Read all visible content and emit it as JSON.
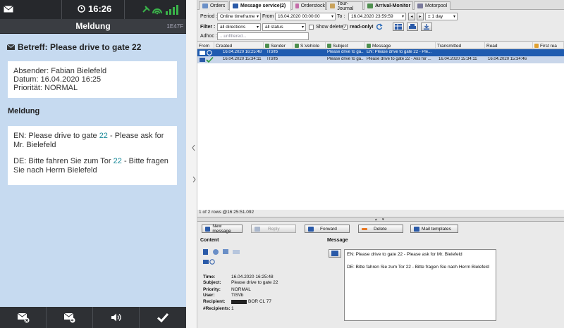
{
  "mobile": {
    "status_bar": {
      "time": "16:26"
    },
    "title": "Meldung",
    "code": "1E47F",
    "subject": "Betreff: Please drive to gate 22",
    "details": {
      "sender": "Absender: Fabian Bielefeld",
      "date": "Datum: 16.04.2020 16:25",
      "priority": "Priorität: NORMAL"
    },
    "message_heading": "Meldung",
    "message_en": {
      "before": "EN: Please drive to gate ",
      "gate": "22",
      "after": " - Please ask for Mr. Bielefeld"
    },
    "message_de": {
      "before": "DE: Bitte fahren Sie zum Tor ",
      "gate": "22",
      "after": " - Bitte fragen Sie nach Herrn Bielefeld"
    },
    "bottom_buttons": [
      "mail-delete-icon",
      "mail-reply-icon",
      "speaker-icon",
      "checkmark-icon"
    ]
  },
  "desktop": {
    "tabs": [
      "Orders",
      "Message service(2)",
      "Orderstock",
      "Tour-Journal",
      "Arrival-Monitor",
      "Motorpool"
    ],
    "period": {
      "label": "Period :",
      "value": "Online timeframe",
      "from_label": "From :",
      "from_value": "16.04.2020 00:00:00",
      "to_label": "To :",
      "to_value": "16.04.2020 23:59:59",
      "step": "± 1 day"
    },
    "filter": {
      "label": "Filter :",
      "directions": "all directions",
      "status": "all status",
      "show_deleted": "Show deleted",
      "read_only": "read-only!"
    },
    "adhoc": {
      "label": "Adhoc :",
      "placeholder": "...unfiltered..."
    },
    "columns": [
      "From",
      "Created",
      "Sender",
      "S.Vehicle",
      "Subject",
      "Message",
      "Transmitted",
      "Read",
      "First rea"
    ],
    "rows": [
      {
        "created": "16.04.2020 16:25:48",
        "sender": "TIS\\fb",
        "vehicle": "",
        "subject": "Please drive to ga...",
        "message": "EN: Please drive to gate 22 - Ple...",
        "transmitted": "",
        "read": "",
        "selected": true
      },
      {
        "created": "16.04.2020 15:34:11",
        "sender": "TIS\\fb",
        "vehicle": "",
        "subject": "Please drive to ga...",
        "message": "Please drive to gate 22 - Aks for ...",
        "transmitted": "16.04.2020 15:34:11",
        "read": "16.04.2020 15:34:46",
        "selected": false
      }
    ],
    "row_count": "1 of 2 rows @16:25:51.092",
    "actions": [
      "New message",
      "Reply",
      "Forward",
      "Delete",
      "Mail templates"
    ],
    "content": {
      "heading": "Content",
      "time_label": "Time:",
      "time": "16.04.2020 16:25:48",
      "subject_label": "Subject:",
      "subject": "Please drive to gate 22",
      "priority_label": "Priority:",
      "priority": "NORMAL",
      "user_label": "User:",
      "user": "TIS\\fb",
      "recipient_label": "Recipient:",
      "recipient": "BOR CL 77",
      "recipients_label": "#Recipients:",
      "recipients": "1"
    },
    "message": {
      "heading": "Message",
      "line_en": "EN: Please drive to gate 22 - Please ask for Mr. Bielefeld",
      "line_de": "DE: Bitte fahren Sie zum Tor 22 - Bitte fragen Sie nach Herrn Bielefeld"
    }
  },
  "colors": {
    "mobile_bg": "#c6daf0",
    "selected_row": "#1e5bb0",
    "status_green": "#3ab54a",
    "delete_orange": "#e87722"
  }
}
